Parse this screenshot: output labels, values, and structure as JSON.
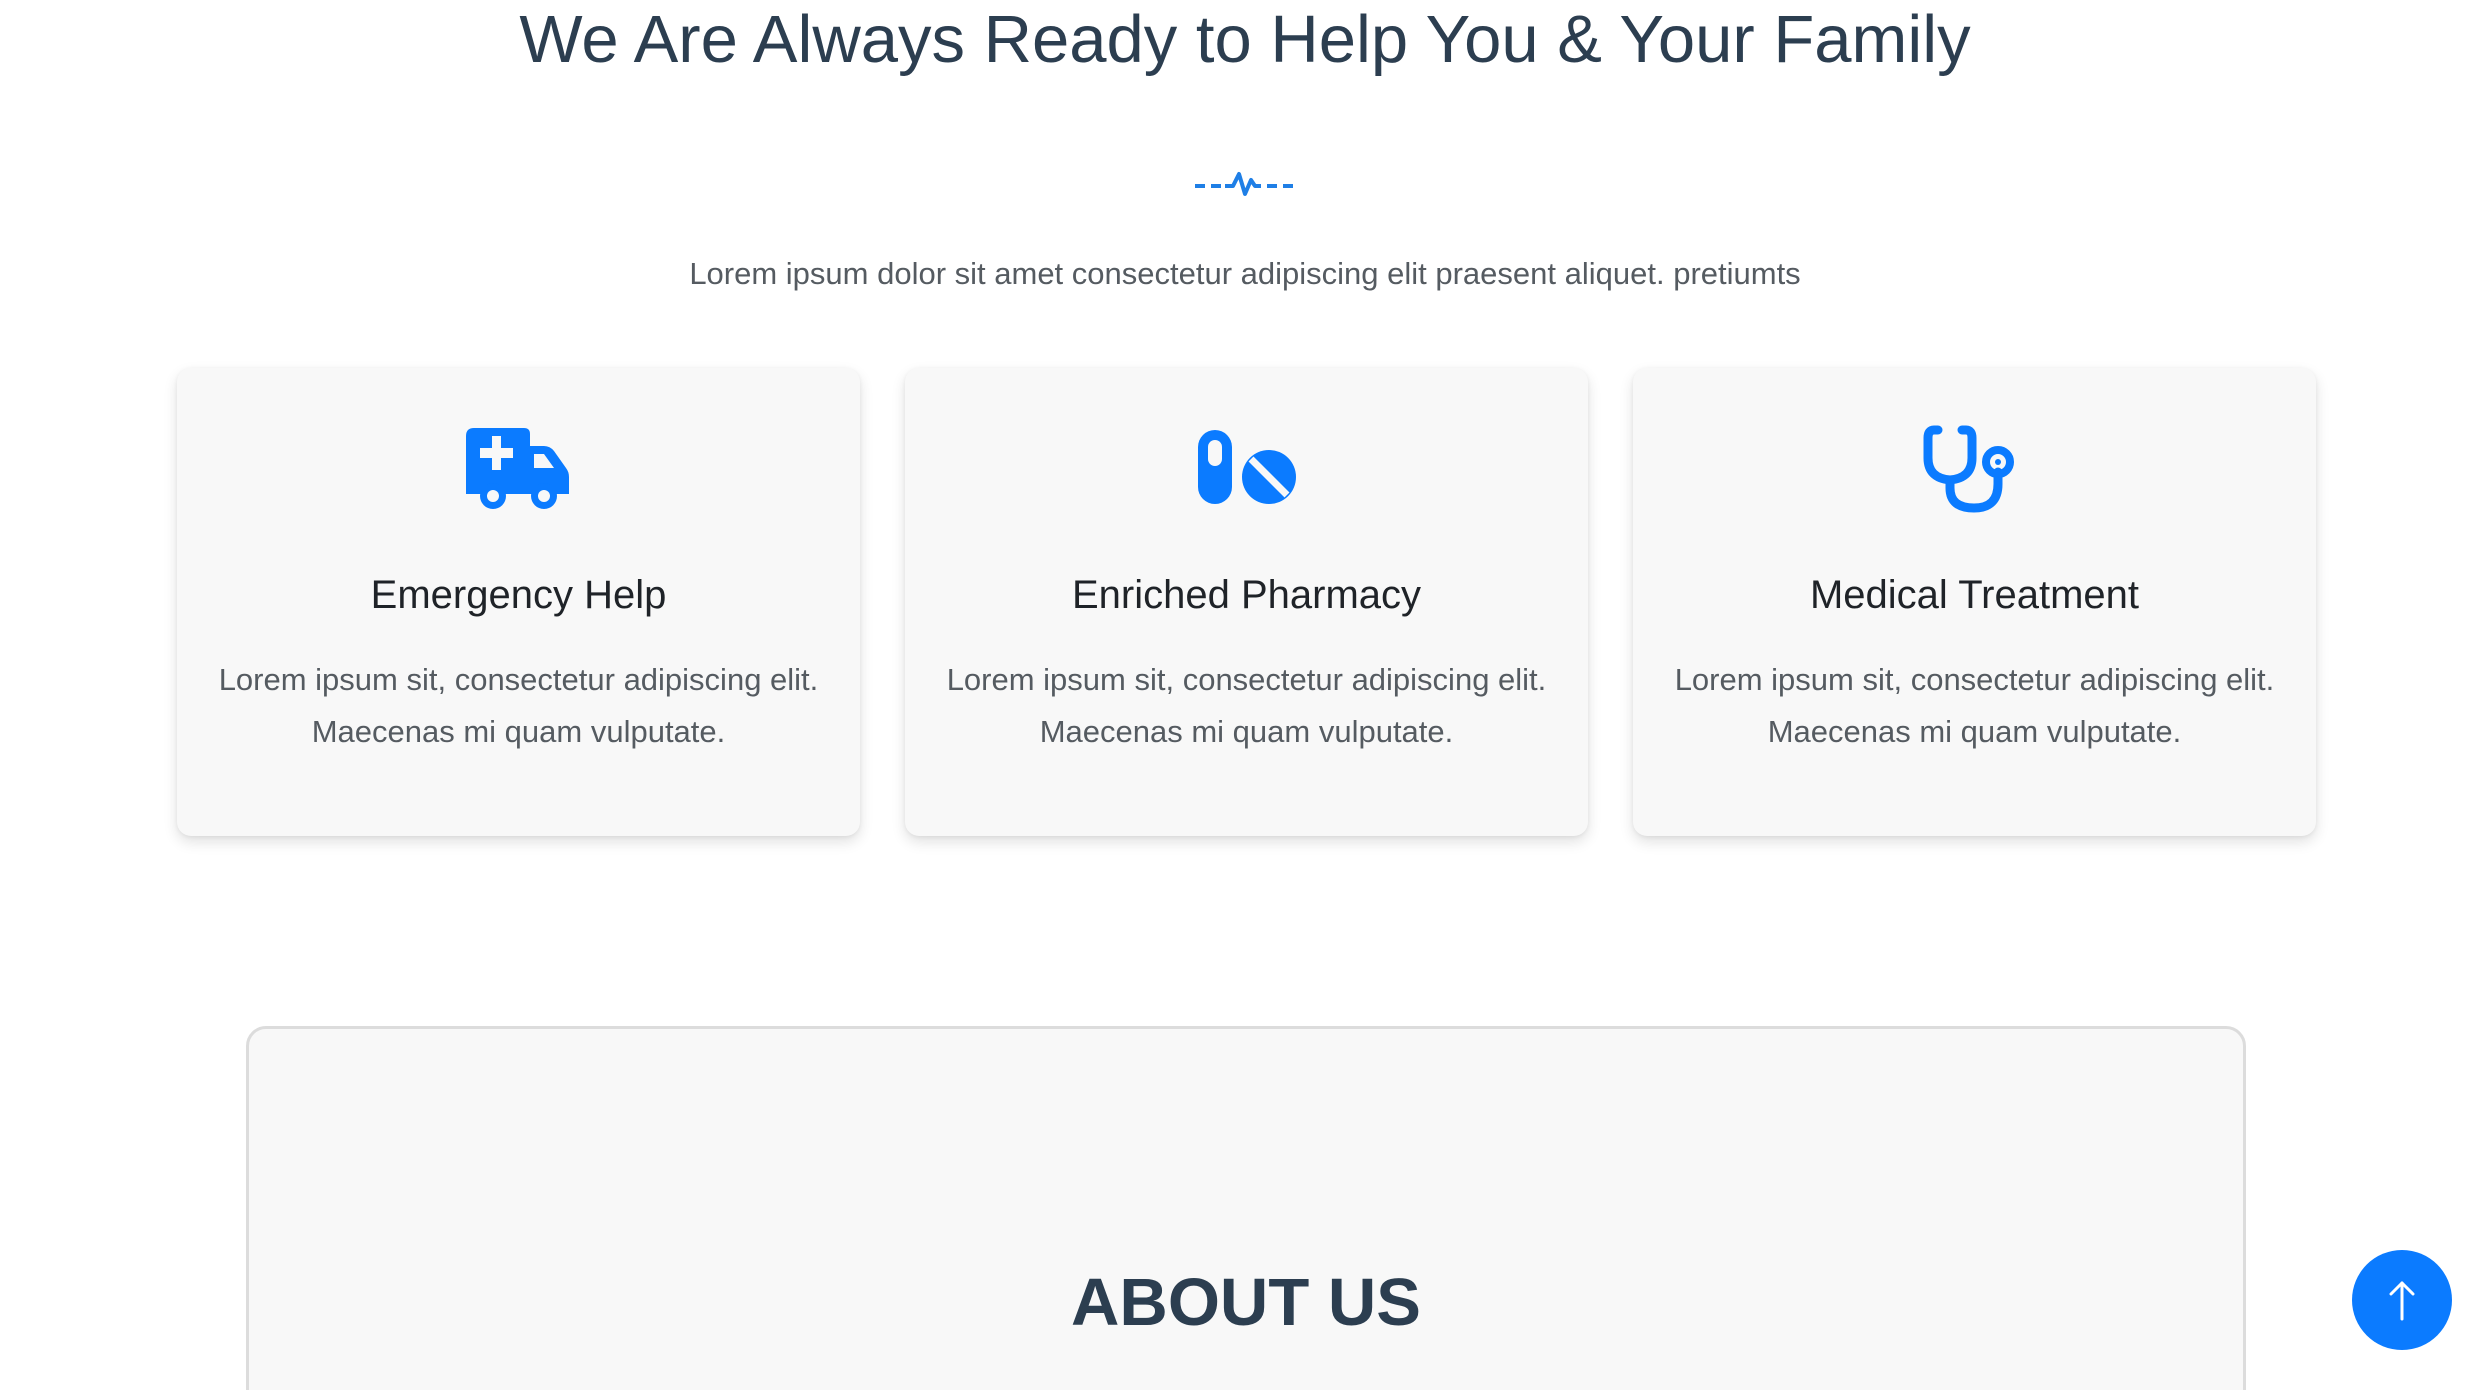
{
  "services_section": {
    "title": "We Are Always Ready to Help You & Your Family",
    "subtitle": "Lorem ipsum dolor sit amet consectetur adipiscing elit praesent aliquet. pretiumts",
    "divider_icon": "heartbeat-pulse-icon",
    "accent_color": "#0b7bff",
    "cards": [
      {
        "icon": "ambulance-icon",
        "title": "Emergency Help",
        "text": "Lorem ipsum sit, consectetur adipiscing elit. Maecenas mi quam vulputate."
      },
      {
        "icon": "pills-icon",
        "title": "Enriched Pharmacy",
        "text": "Lorem ipsum sit, consectetur adipiscing elit. Maecenas mi quam vulputate."
      },
      {
        "icon": "stethoscope-icon",
        "title": "Medical Treatment",
        "text": "Lorem ipsum sit, consectetur adipiscing elit. Maecenas mi quam vulputate."
      }
    ]
  },
  "about_section": {
    "title": "ABOUT US"
  },
  "scroll_top_button": {
    "icon": "arrow-up-icon",
    "color": "#0b7bff"
  }
}
